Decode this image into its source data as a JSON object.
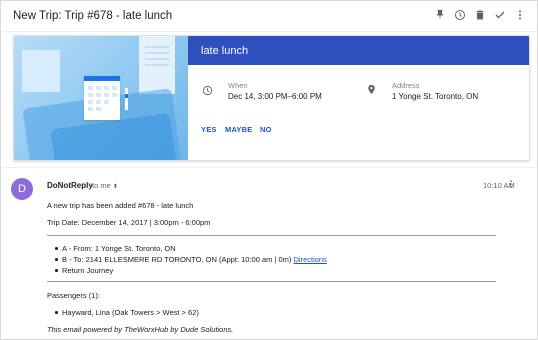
{
  "header": {
    "subject": "New Trip: Trip #678 - late lunch",
    "icons": [
      "pin-icon",
      "clock-icon",
      "trash-icon",
      "check-icon",
      "more-vert-icon"
    ]
  },
  "event": {
    "title": "late lunch",
    "when_label": "When",
    "when_value": "Dec 14, 3:00 PM–6:00 PM",
    "address_label": "Address",
    "address_value": "1 Yonge St. Toronto, ON",
    "rsvp": {
      "yes": "YES",
      "maybe": "MAYBE",
      "no": "NO"
    },
    "accent_color": "#2e4fbd"
  },
  "message": {
    "avatar_letter": "D",
    "avatar_color": "#8e6bd6",
    "sender": "DoNotReply",
    "to": "to me",
    "time": "10:10 AM",
    "intro": "A new trip has been added #678 - late lunch",
    "trip_date": "Trip Date: December 14, 2017 | 3:00pm - 6:00pm",
    "legs": {
      "a": "A - From: 1 Yonge St. Toronto, ON",
      "b_prefix": "B - To: 2141 ELLESMERE RD TORONTO, ON (Appt: 10:00 am | 0m)",
      "b_link": "Directions",
      "return": "Return Journey"
    },
    "passengers_heading": "Passengers (1):",
    "passenger": "Hayward, Lina (Oak Towers > West > 62)",
    "footer": "This email powered by TheWorxHub by Dude Solutions."
  }
}
